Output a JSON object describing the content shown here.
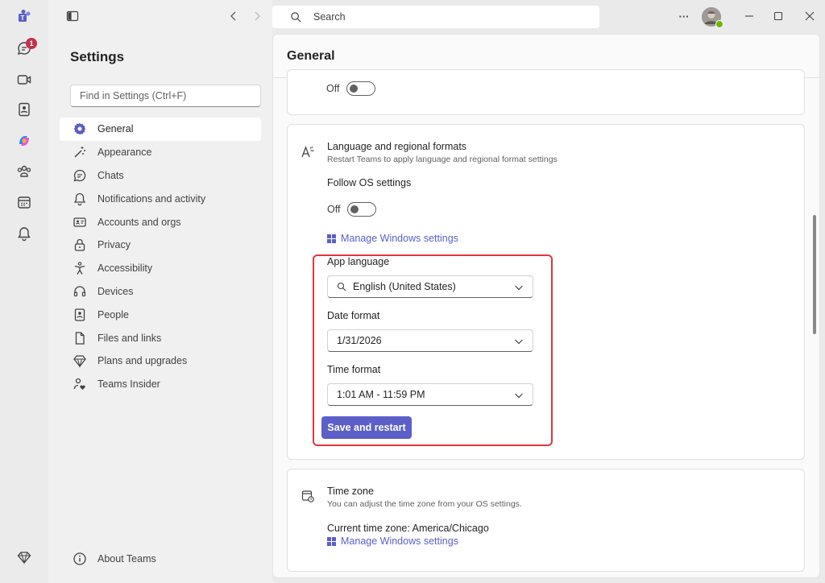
{
  "rail": {
    "items": [
      {
        "name": "teams-logo-icon"
      },
      {
        "name": "chat-icon",
        "badge": "1"
      },
      {
        "name": "video-icon"
      },
      {
        "name": "contacts-icon"
      },
      {
        "name": "copilot-icon"
      },
      {
        "name": "communities-icon"
      },
      {
        "name": "calendar-icon"
      },
      {
        "name": "bell-icon"
      }
    ],
    "bottom_icon": "diamond-icon"
  },
  "topbar": {
    "search_placeholder": "Search",
    "more_label": "···"
  },
  "settings": {
    "title": "Settings",
    "find_placeholder": "Find in Settings (Ctrl+F)",
    "nav": [
      {
        "label": "General",
        "icon": "gear-icon",
        "active": true
      },
      {
        "label": "Appearance",
        "icon": "wand-icon"
      },
      {
        "label": "Chats",
        "icon": "chat-bubble-icon"
      },
      {
        "label": "Notifications and activity",
        "icon": "bell-icon"
      },
      {
        "label": "Accounts and orgs",
        "icon": "id-card-icon"
      },
      {
        "label": "Privacy",
        "icon": "lock-icon"
      },
      {
        "label": "Accessibility",
        "icon": "accessibility-icon"
      },
      {
        "label": "Devices",
        "icon": "headset-icon"
      },
      {
        "label": "People",
        "icon": "person-card-icon"
      },
      {
        "label": "Files and links",
        "icon": "file-icon"
      },
      {
        "label": "Plans and upgrades",
        "icon": "diamond-icon"
      },
      {
        "label": "Teams Insider",
        "icon": "person-heart-icon"
      }
    ],
    "about_label": "About Teams"
  },
  "main": {
    "title": "General",
    "top_card": {
      "toggle_label": "Off",
      "toggle_on": false
    },
    "language": {
      "title": "Language and regional formats",
      "subtitle": "Restart Teams to apply language and regional format settings",
      "follow_os_label": "Follow OS settings",
      "follow_os_toggle_label": "Off",
      "follow_os_on": false,
      "manage_link": "Manage Windows settings",
      "app_language_label": "App language",
      "app_language_value": "English (United States)",
      "date_format_label": "Date format",
      "date_format_value": "1/31/2026",
      "time_format_label": "Time format",
      "time_format_value": "1:01 AM - 11:59 PM",
      "save_button": "Save and restart"
    },
    "timezone": {
      "title": "Time zone",
      "subtitle": "You can adjust the time zone from your OS settings.",
      "current": "Current time zone: America/Chicago",
      "manage_link": "Manage Windows settings"
    }
  },
  "colors": {
    "accent": "#5b5fc7",
    "highlight": "#e0363b",
    "badge": "#c4314b",
    "presence": "#6bb700"
  }
}
